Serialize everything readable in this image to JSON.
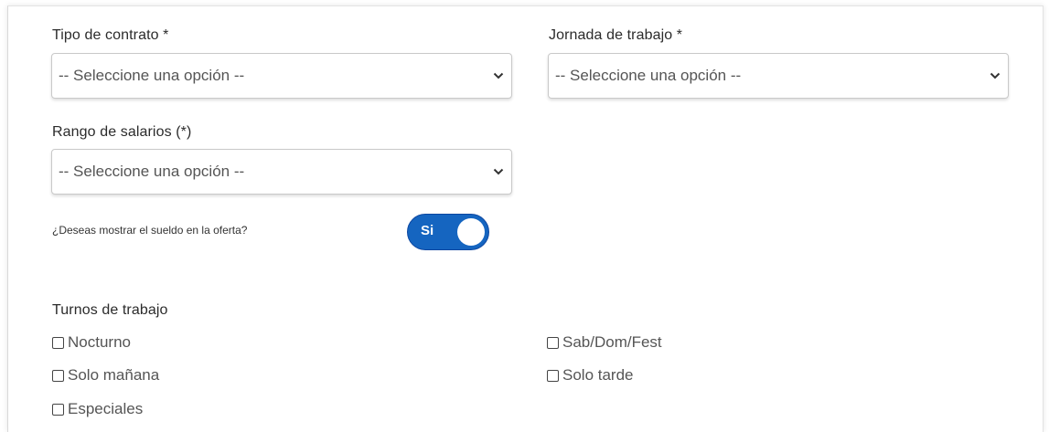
{
  "form": {
    "contract_type": {
      "label": "Tipo de contrato *",
      "selected": "-- Seleccione una opción --"
    },
    "work_schedule": {
      "label": "Jornada de trabajo *",
      "selected": "-- Seleccione una opción --"
    },
    "salary_range": {
      "label": "Rango de salarios (*)",
      "selected": "-- Seleccione una opción --"
    },
    "show_salary": {
      "question": "¿Deseas mostrar el sueldo en la oferta?",
      "toggle_label": "Si",
      "checked": true
    },
    "shifts": {
      "label": "Turnos de trabajo",
      "options": [
        "Nocturno",
        "Sab/Dom/Fest",
        "Solo mañana",
        "Solo tarde",
        "Especiales"
      ]
    }
  },
  "colors": {
    "toggle_on": "#1565c0"
  },
  "icons": {
    "select_arrow": "chevron-down-icon",
    "checkbox": "checkbox-unchecked-icon"
  }
}
